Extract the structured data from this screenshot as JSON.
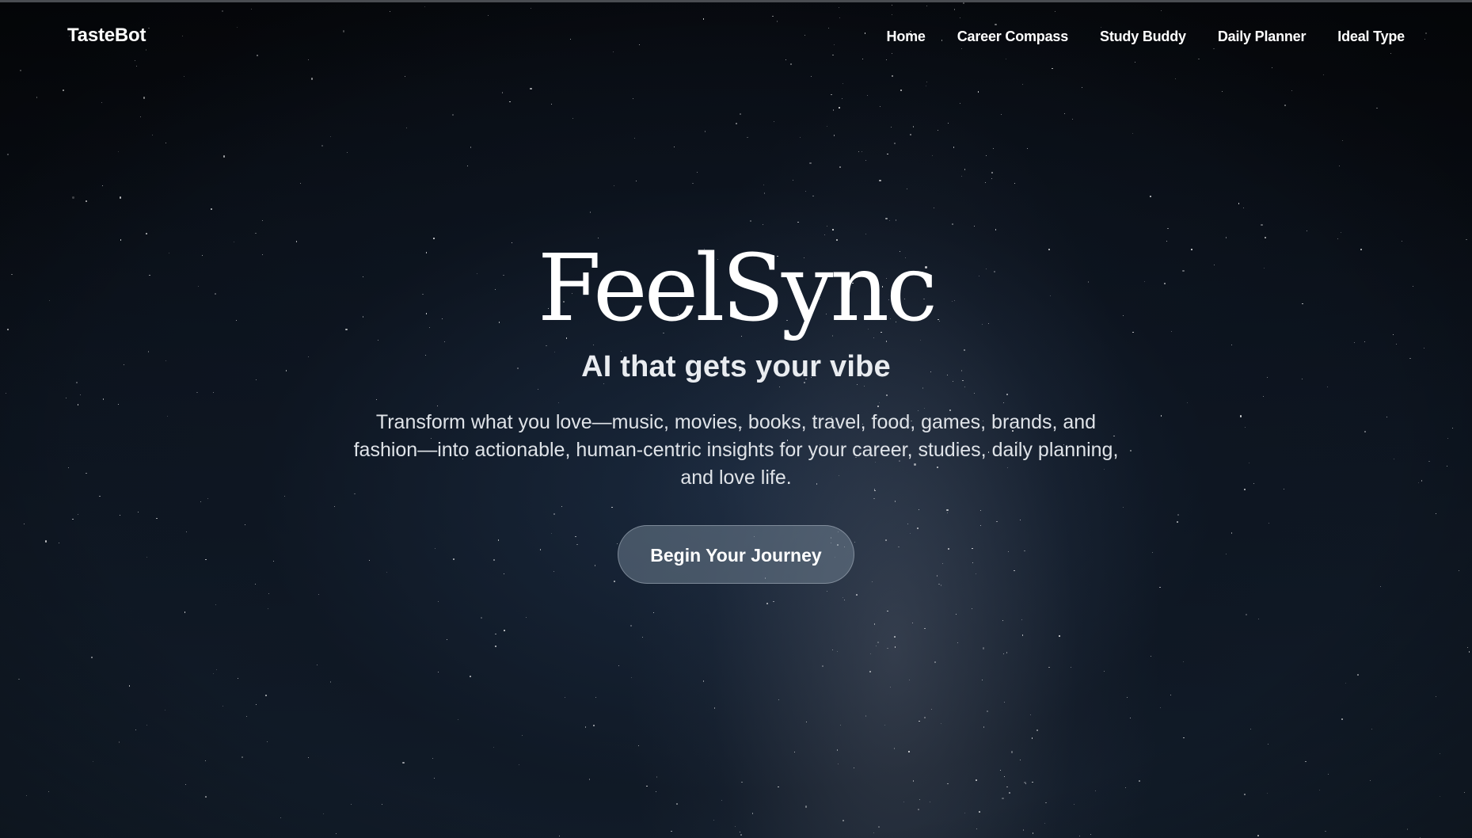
{
  "navbar": {
    "brand": "TasteBot",
    "links": [
      {
        "label": "Home"
      },
      {
        "label": "Career Compass"
      },
      {
        "label": "Study Buddy"
      },
      {
        "label": "Daily Planner"
      },
      {
        "label": "Ideal Type"
      }
    ]
  },
  "hero": {
    "title": "FeelSync",
    "subtitle": "AI that gets your vibe",
    "description": "Transform what you love—music, movies, books, travel, food, games, brands, and fashion—into actionable, human-centric insights for your career, studies, daily planning, and love life.",
    "cta_label": "Begin Your Journey"
  },
  "colors": {
    "background": "#07090d",
    "text": "#ffffff",
    "button_bg": "#4f5b68"
  }
}
